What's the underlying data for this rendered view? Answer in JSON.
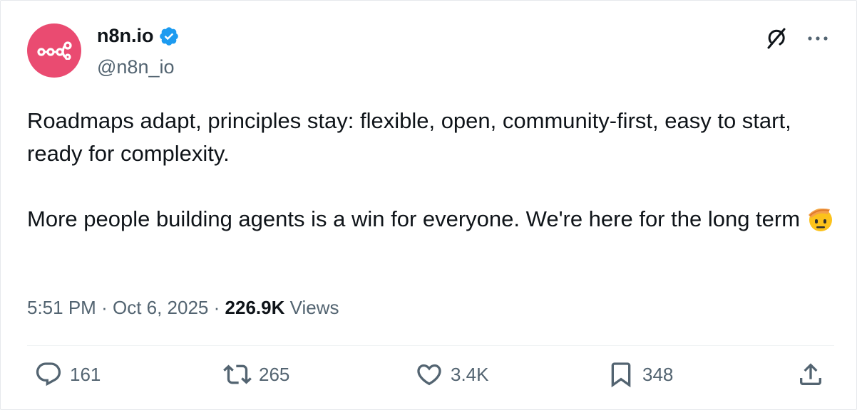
{
  "user": {
    "display_name": "n8n.io",
    "handle": "@n8n_io",
    "verified": true,
    "avatar_color": "#EA4B71"
  },
  "tweet": {
    "paragraph1": "Roadmaps adapt, principles stay: flexible, open, community-first, easy to start, ready for complexity.",
    "paragraph2": "More people building agents is a win for everyone. We're here for the long term",
    "emoji": "saluting-face"
  },
  "meta": {
    "time": "5:51 PM",
    "separator": "·",
    "date": "Oct 6, 2025",
    "views_count": "226.9K",
    "views_label": "Views"
  },
  "actions": {
    "replies": "161",
    "reposts": "265",
    "likes": "3.4K",
    "bookmarks": "348"
  },
  "colors": {
    "text_primary": "#0f1419",
    "text_secondary": "#536471",
    "verified_blue": "#1d9bf0"
  },
  "icons": [
    "grok-icon",
    "more-icon",
    "reply-icon",
    "retweet-icon",
    "like-icon",
    "bookmark-icon",
    "share-icon",
    "verified-badge-icon"
  ]
}
